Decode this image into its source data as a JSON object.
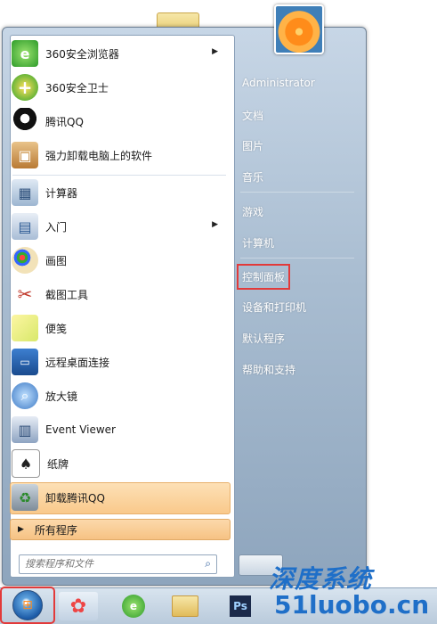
{
  "start_menu": {
    "pinned": [
      {
        "label": "360安全浏览器",
        "icon": "browser-360-icon",
        "has_submenu": true
      },
      {
        "label": "360安全卫士",
        "icon": "security-360-icon",
        "has_submenu": false
      },
      {
        "label": "腾讯QQ",
        "icon": "qq-penguin-icon",
        "has_submenu": false
      },
      {
        "label": "强力卸载电脑上的软件",
        "icon": "uninstall-box-icon",
        "has_submenu": false
      }
    ],
    "recent": [
      {
        "label": "计算器",
        "icon": "calculator-icon",
        "has_submenu": false
      },
      {
        "label": "入门",
        "icon": "getting-started-icon",
        "has_submenu": true
      },
      {
        "label": "画图",
        "icon": "paint-palette-icon",
        "has_submenu": false
      },
      {
        "label": "截图工具",
        "icon": "snipping-tool-icon",
        "has_submenu": false
      },
      {
        "label": "便笺",
        "icon": "sticky-notes-icon",
        "has_submenu": false
      },
      {
        "label": "远程桌面连接",
        "icon": "remote-desktop-icon",
        "has_submenu": false
      },
      {
        "label": "放大镜",
        "icon": "magnifier-icon",
        "has_submenu": false
      },
      {
        "label": "Event Viewer",
        "icon": "event-viewer-icon",
        "has_submenu": false
      },
      {
        "label": "纸牌",
        "icon": "solitaire-icon",
        "has_submenu": false
      }
    ],
    "highlighted": {
      "label": "卸载腾讯QQ",
      "icon": "recycle-bin-icon"
    },
    "all_programs": "所有程序",
    "search_placeholder": "搜索程序和文件",
    "right": {
      "user": "Administrator",
      "items": [
        "文档",
        "图片",
        "音乐",
        "游戏",
        "计算机",
        "控制面板",
        "设备和打印机",
        "默认程序",
        "帮助和支持"
      ]
    }
  },
  "watermark": {
    "name": "深度系统",
    "domain": "51luobo.cn"
  },
  "colors": {
    "highlight_box": "#e23a3a",
    "menu_right_bg": "#8ea5bd",
    "item_highlight": "#f9c98b"
  }
}
